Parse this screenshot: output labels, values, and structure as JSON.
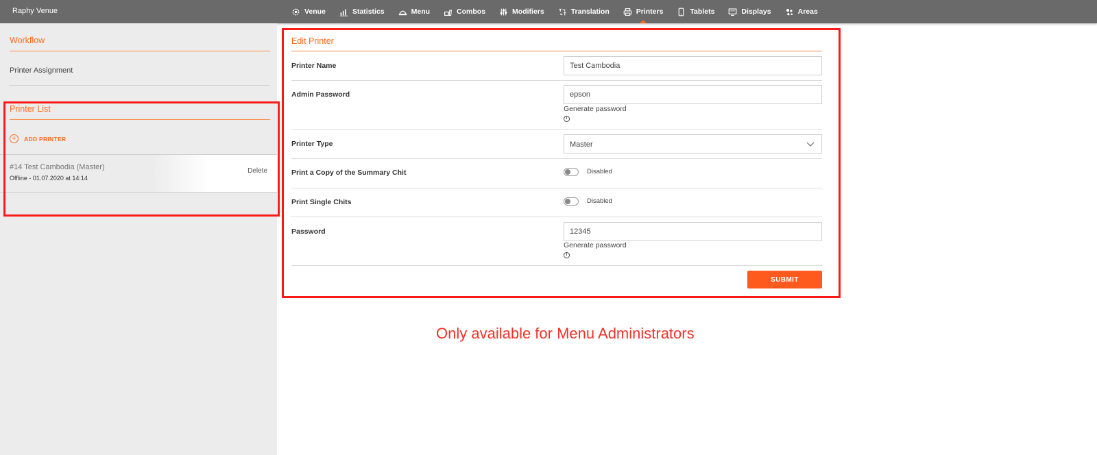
{
  "venue_name": "Raphy Venue",
  "nav": [
    {
      "label": "Venue",
      "icon": "gear-icon"
    },
    {
      "label": "Statistics",
      "icon": "chart-icon"
    },
    {
      "label": "Menu",
      "icon": "cloche-icon"
    },
    {
      "label": "Combos",
      "icon": "combo-icon"
    },
    {
      "label": "Modifiers",
      "icon": "sliders-icon"
    },
    {
      "label": "Translation",
      "icon": "translate-icon"
    },
    {
      "label": "Printers",
      "icon": "printer-icon",
      "active": true
    },
    {
      "label": "Tablets",
      "icon": "tablet-icon"
    },
    {
      "label": "Displays",
      "icon": "display-icon"
    },
    {
      "label": "Areas",
      "icon": "areas-icon"
    }
  ],
  "sidebar": {
    "workflow_title": "Workflow",
    "workflow_item": "Printer Assignment",
    "printer_list_title": "Printer List",
    "add_printer": "ADD PRINTER",
    "printers": [
      {
        "name": "#14 Test Cambodia (Master)",
        "status": "Offline - 01.07.2020 at 14:14",
        "delete": "Delete"
      }
    ]
  },
  "form": {
    "title": "Edit Printer",
    "printer_name_label": "Printer Name",
    "printer_name_value": "Test Cambodia",
    "admin_password_label": "Admin Password",
    "admin_password_value": "epson",
    "generate_password": "Generate password",
    "printer_type_label": "Printer Type",
    "printer_type_value": "Master",
    "summary_chit_label": "Print a Copy of the Summary Chit",
    "summary_chit_state": "Disabled",
    "single_chits_label": "Print Single Chits",
    "single_chits_state": "Disabled",
    "password_label": "Password",
    "password_value": "12345",
    "submit": "SUBMIT"
  },
  "annotation": "Only available for Menu Administrators",
  "colors": {
    "accent": "#ff6a1a",
    "annotation": "#ff1a1a",
    "topbar": "#6a6a6a"
  }
}
